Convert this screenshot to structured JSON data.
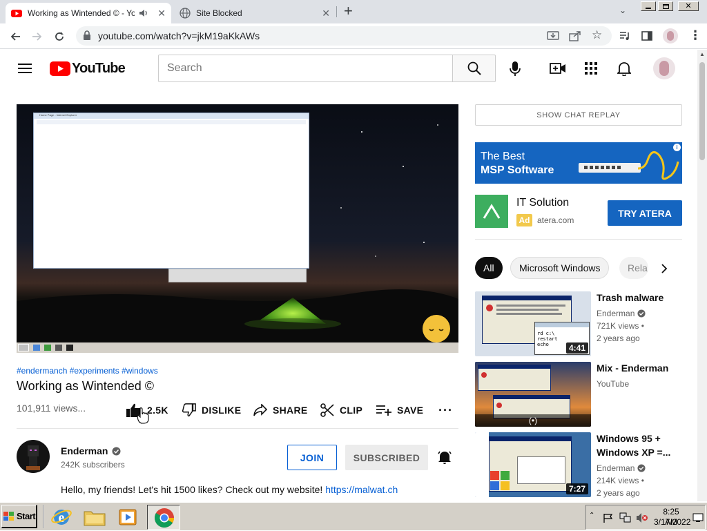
{
  "browser": {
    "tabs": [
      {
        "title": "Working as Wintended © - YouTube",
        "active": true
      },
      {
        "title": "Site Blocked",
        "active": false
      }
    ],
    "new_tab": "+",
    "url": "youtube.com/watch?v=jkM19aKkAWs"
  },
  "yt": {
    "logo_text": "YouTube",
    "search_placeholder": "Search"
  },
  "video": {
    "hashtags": "#endermanch #experiments #windows",
    "title": "Working as Wintended ©",
    "views": "101,911 views...",
    "actions": {
      "like": "2.5K",
      "dislike": "DISLIKE",
      "share": "SHARE",
      "clip": "CLIP",
      "save": "SAVE"
    }
  },
  "channel": {
    "name": "Enderman",
    "subscribers": "242K subscribers",
    "join": "JOIN",
    "subscribed": "SUBSCRIBED"
  },
  "description": {
    "text": "Hello, my friends! Let's hit 1500 likes? Check out my website! ",
    "link": "https://malwat.ch"
  },
  "sidebar": {
    "chat_replay": "SHOW CHAT REPLAY",
    "ad_banner": {
      "line1": "The Best",
      "line2": "MSP Software"
    },
    "ad": {
      "title": "IT Solution",
      "badge": "Ad",
      "domain": "atera.com",
      "cta": "TRY ATERA"
    },
    "chips": [
      "All",
      "Microsoft Windows",
      "Rela"
    ],
    "videos": [
      {
        "title": "Trash malware",
        "channel": "Enderman",
        "views": "721K views •",
        "age": "2 years ago",
        "duration": "4:41"
      },
      {
        "title": "Mix - Enderman",
        "channel": "YouTube",
        "views": "",
        "age": "",
        "duration": ""
      },
      {
        "title": "Windows 95 + Windows XP =...",
        "channel": "Enderman",
        "views": "214K views •",
        "age": "2 years ago",
        "duration": "7:27"
      }
    ]
  },
  "player_overlay": {
    "window_title": "Home Page - Internet Explorer"
  },
  "taskbar": {
    "start": "Start",
    "time": "8:25 AM",
    "date": "3/17/2022"
  },
  "colors": {
    "yt_red": "#ff0000",
    "link_blue": "#065fd4",
    "ad_blue": "#1565c0",
    "atera_green": "#3dae5f",
    "ad_badge": "#f2c94c"
  }
}
